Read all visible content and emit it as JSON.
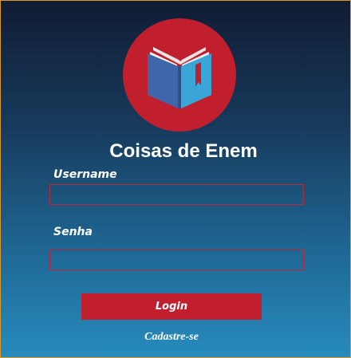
{
  "app": {
    "title": "Coisas de Enem",
    "logo_icon": "open-book-icon"
  },
  "form": {
    "username_label": "Username",
    "username_value": "",
    "password_label": "Senha",
    "password_value": "",
    "login_label": "Login",
    "signup_label": "Cadastre-se"
  },
  "colors": {
    "accent": "#c11f2e",
    "background_top": "#101c33",
    "background_bottom": "#278bbd",
    "text": "#ffffff"
  }
}
